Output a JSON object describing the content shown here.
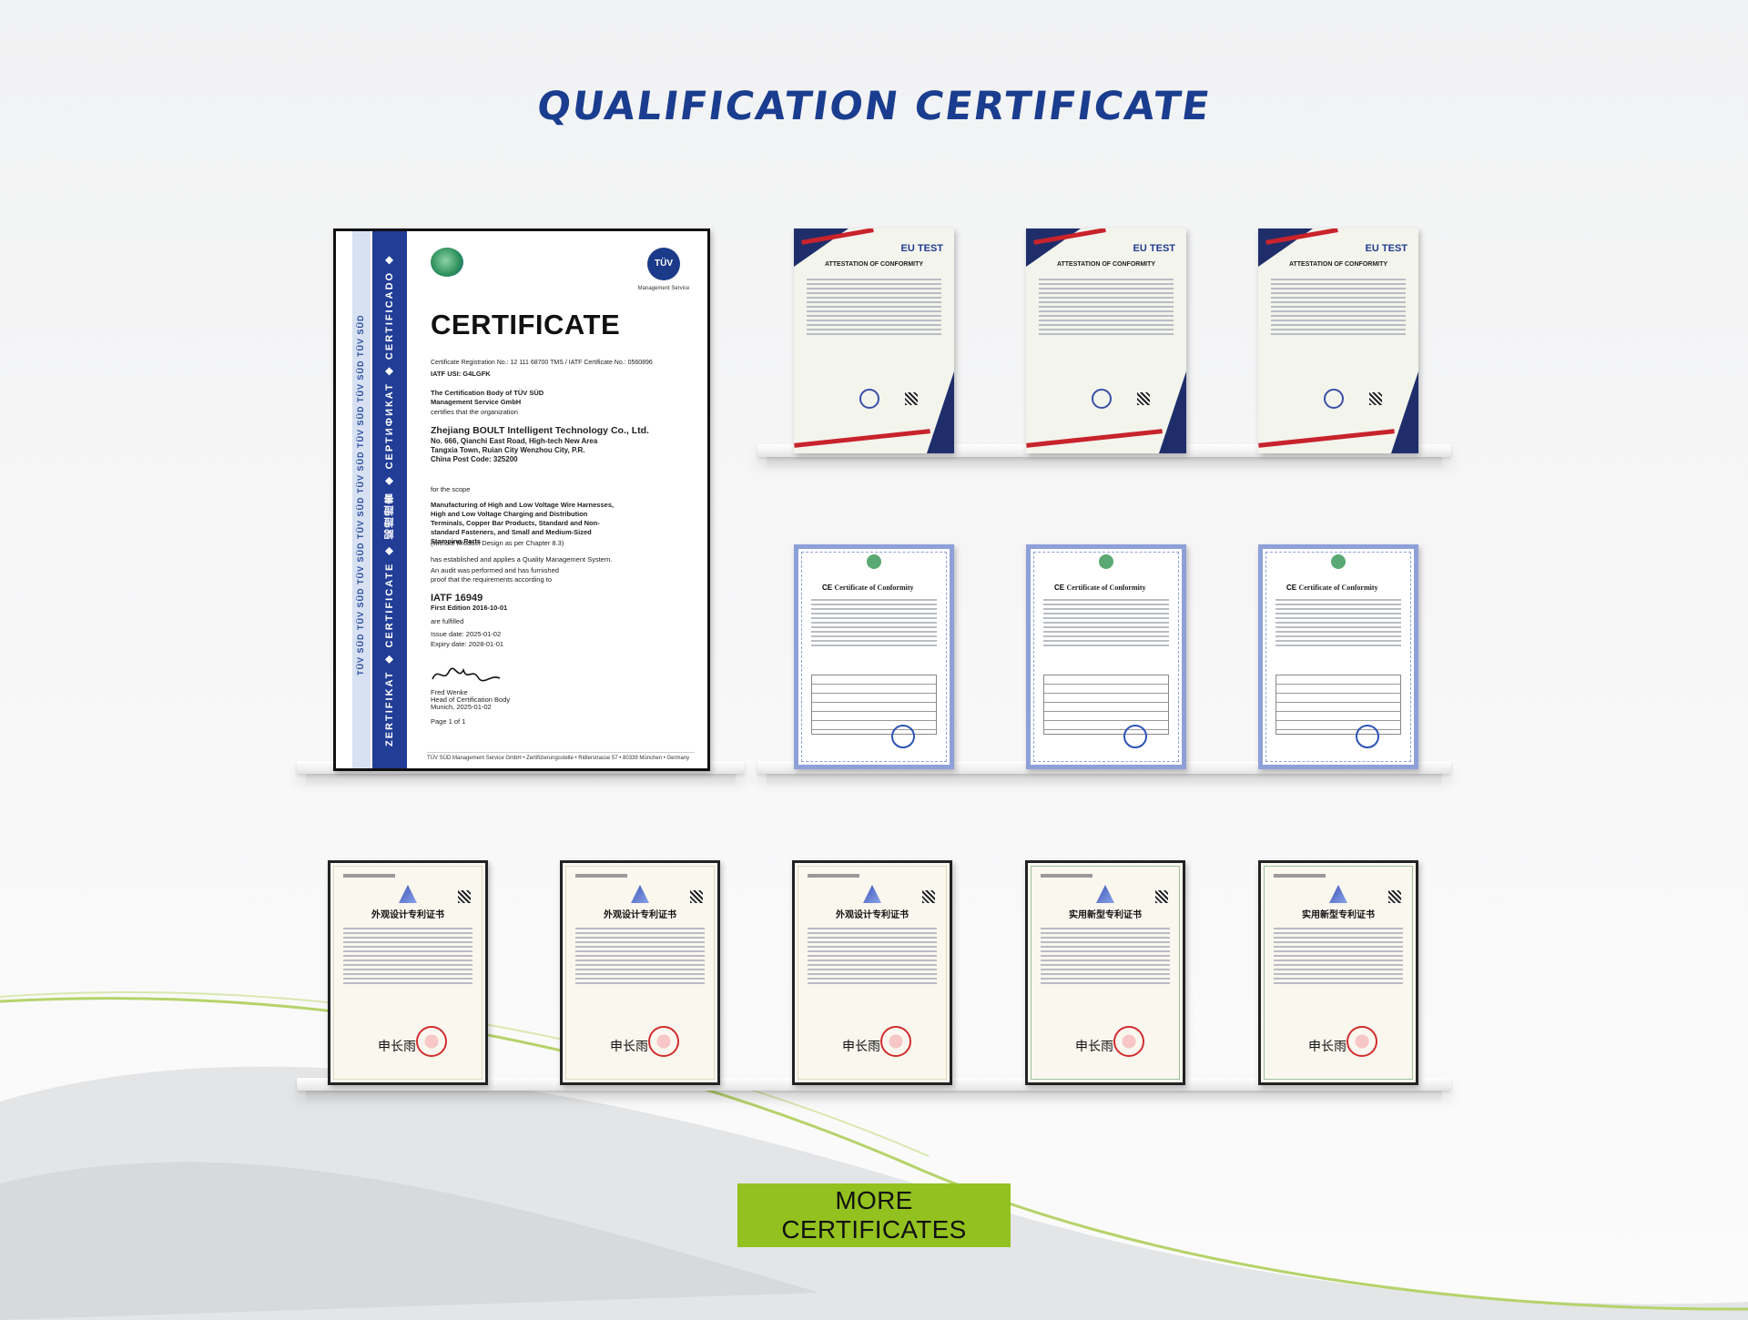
{
  "page_title": "QUALIFICATION CERTIFICATE",
  "more_button": "MORE CERTIFICATES",
  "colors": {
    "title": "#1a3d8f",
    "button": "#93c11f",
    "tuv_band": "#223d96"
  },
  "tuv_certificate": {
    "heading": "CERTIFICATE",
    "stripe_text": "TÜV SÜD TÜV SÜD TÜV SÜD TÜV SÜD TÜV SÜD TÜV SÜD TÜV SÜD TÜV SÜD",
    "band_text": "ZERTIFIKAT ◆ CERTIFICATE ◆ 認證證書 ◆ СЕРТИФИКАТ ◆ CERTIFICADO ◆ CERTIFICAT",
    "logo_right": "TÜV",
    "logo_right_sub": "Management Service",
    "registration": "Certificate Registration No.: 12 111 68700 TMS / IATF Certificate No.: 0560896",
    "iatf_usi": "IATF USI: G4LGFK",
    "body_intro": "The Certification Body of TÜV SÜD Management Service GmbH",
    "certifies": "certifies that the organization",
    "organization": "Zhejiang BOULT Intelligent Technology Co., Ltd.",
    "address": "No. 666, Qianchi East Road, High-tech New Area Tangxia Town, Ruian City Wenzhou City, P.R. China Post Code: 325200",
    "scope_label": "for the scope",
    "scope": "Manufacturing of High and Low Voltage Wire Harnesses, High and Low Voltage Charging and Distribution Terminals, Copper Bar Products, Standard and Non-standard Fasteners, and Small and Medium-Sized Stamping Parts",
    "scope_note": "(without Product Design as per Chapter 8.3)",
    "qms": "has established and applies a Quality Management System.",
    "audit": "An audit was performed and has furnished proof that the requirements according to",
    "standard": "IATF 16949",
    "edition": "First Edition 2016-10-01",
    "fulfilled": "are fulfilled",
    "issue_date": "Issue date: 2025-01-02",
    "expiry_date": "Expiry date: 2028-01-01",
    "signer": "Fred Wenke",
    "signer_title": "Head of Certification Body",
    "signer_place": "Munich, 2025-01-02",
    "page": "Page 1 of 1",
    "footer": "TÜV SÜD Management Service GmbH • Zertifizierungsstelle • Ridlerstrasse 57 • 80339 München • Germany"
  },
  "eu_cards": [
    {
      "logo": "EU TEST",
      "title": "ATTESTATION OF CONFORMITY"
    },
    {
      "logo": "EU TEST",
      "title": "ATTESTATION OF CONFORMITY"
    },
    {
      "logo": "EU TEST",
      "title": "ATTESTATION OF CONFORMITY"
    }
  ],
  "ce_cards": [
    {
      "mark": "CE",
      "title": "Certificate of Conformity"
    },
    {
      "mark": "CE",
      "title": "Certificate of Conformity"
    },
    {
      "mark": "CE",
      "title": "Certificate of Conformity"
    }
  ],
  "patent_cards": [
    {
      "title": "外观设计专利证书",
      "signature": "申长雨"
    },
    {
      "title": "外观设计专利证书",
      "signature": "申长雨"
    },
    {
      "title": "外观设计专利证书",
      "signature": "申长雨"
    },
    {
      "title": "实用新型专利证书",
      "signature": "申长雨"
    },
    {
      "title": "实用新型专利证书",
      "signature": "申长雨"
    }
  ]
}
